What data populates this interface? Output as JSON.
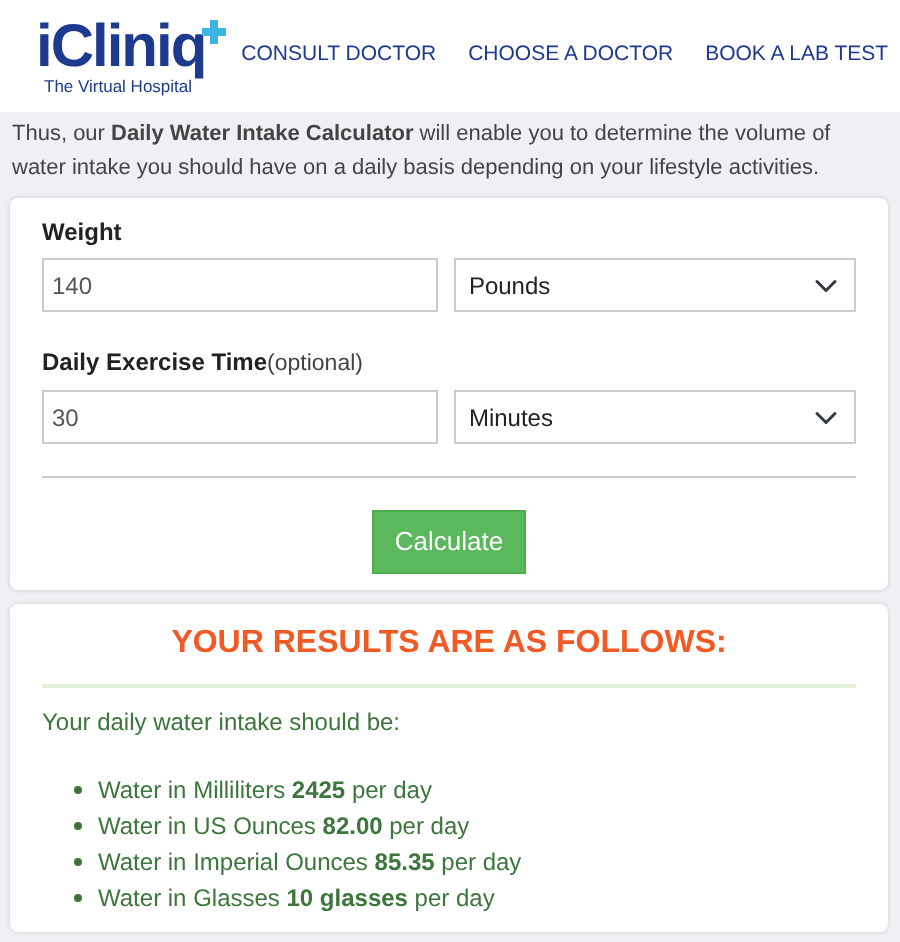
{
  "header": {
    "logo": {
      "name": "iCliniq",
      "tagline": "The Virtual Hospital"
    },
    "nav": [
      {
        "label": "CONSULT DOCTOR"
      },
      {
        "label": "CHOOSE A DOCTOR"
      },
      {
        "label": "BOOK A LAB TEST"
      }
    ]
  },
  "intro": "Thus, our **Daily Water Intake Calculator** will enable you to determine the volume of water intake you should have on a daily basis depending on your lifestyle activities.",
  "form": {
    "fields": [
      {
        "label": "Weight",
        "value": "140",
        "unit": "Pounds"
      },
      {
        "label": "Daily Exercise Time",
        "note": "(optional)",
        "value": "30",
        "unit": "Minutes"
      }
    ],
    "button": "Calculate"
  },
  "results": {
    "title": "YOUR RESULTS ARE AS FOLLOWS:",
    "lead": "Your daily water intake should be:",
    "items": [
      "Water in Milliliters **2425** per day",
      "Water in US Ounces **82.00** per day",
      "Water in Imperial Ounces **85.35** per day",
      "Water in Glasses **10 glasses** per day"
    ]
  }
}
